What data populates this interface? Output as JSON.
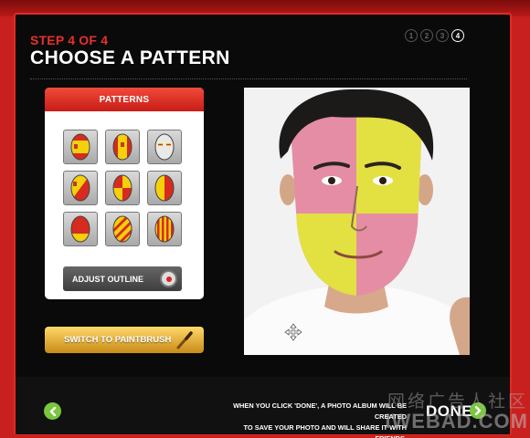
{
  "header": {
    "step_label": "STEP 4 OF 4",
    "title": "CHOOSE A PATTERN",
    "steps": [
      "1",
      "2",
      "3",
      "4"
    ],
    "current_step": 4
  },
  "patterns_panel": {
    "title": "PATTERNS",
    "items": [
      {
        "name": "spain-flag-pattern"
      },
      {
        "name": "vertical-stripes-pattern"
      },
      {
        "name": "eyes-only-pattern"
      },
      {
        "name": "diagonal-split-pattern"
      },
      {
        "name": "quartered-pattern"
      },
      {
        "name": "vertical-halves-pattern"
      },
      {
        "name": "horizontal-halves-pattern"
      },
      {
        "name": "diagonal-stripes-pattern"
      },
      {
        "name": "thin-stripes-pattern"
      }
    ],
    "adjust_outline_label": "ADJUST OUTLINE"
  },
  "paintbrush_button_label": "SWITCH TO PAINTBRUSH",
  "footer": {
    "info_line1": "WHEN YOU CLICK 'DONE', A PHOTO ALBUM WILL BE CREATED",
    "info_line2": "TO SAVE YOUR PHOTO AND WILL SHARE IT WITH FRIENDS.",
    "done_label": "DONE"
  },
  "watermark": {
    "line1": "网络广告人社区",
    "line2": "IWEBAD.COM"
  },
  "colors": {
    "accent_red": "#e8302a",
    "pattern_yellow": "#e8e83c",
    "pattern_pink": "#e68aa8",
    "nav_green": "#7ac63e"
  }
}
